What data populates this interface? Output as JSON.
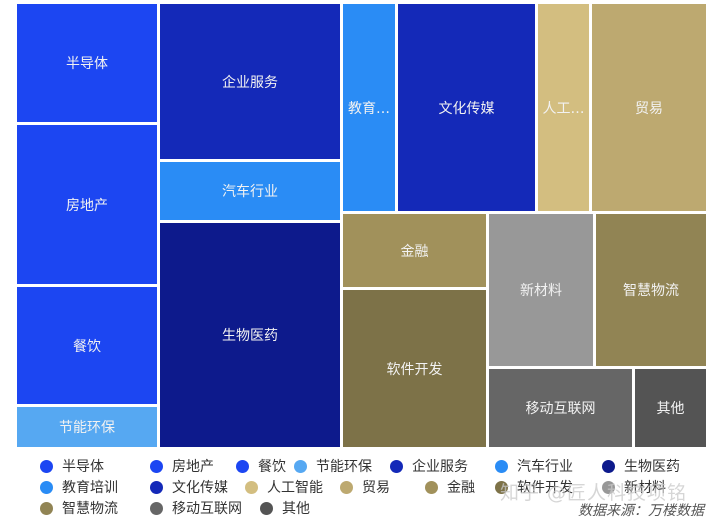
{
  "chart_data": {
    "type": "treemap",
    "title": "",
    "source": "数据来源：万楼数据",
    "watermark": "知乎 @匠人科技项铭",
    "items": [
      {
        "name": "半导体",
        "label": "半导体",
        "value": 16.7,
        "color": "#1c46f2"
      },
      {
        "name": "房地产",
        "label": "房地产",
        "value": 22.4,
        "color": "#1c46f2"
      },
      {
        "name": "餐饮",
        "label": "餐饮",
        "value": 16.5,
        "color": "#1c46f2"
      },
      {
        "name": "节能环保",
        "label": "节能环保",
        "value": 5.5,
        "color": "#56a8f2"
      },
      {
        "name": "企业服务",
        "label": "企业服务",
        "value": 28.1,
        "color": "#1429b8"
      },
      {
        "name": "汽车行业",
        "label": "汽车行业",
        "value": 10.8,
        "color": "#2a8cf5"
      },
      {
        "name": "生物医药",
        "label": "生物医药",
        "value": 39.8,
        "color": "#0d1a8c"
      },
      {
        "name": "教育培训",
        "label": "教育…",
        "value": 11.0,
        "color": "#2a8cf5"
      },
      {
        "name": "文化传媒",
        "label": "文化传媒",
        "value": 27.9,
        "color": "#1429b8"
      },
      {
        "name": "人工智能",
        "label": "人工…",
        "value": 10.8,
        "color": "#d3be80"
      },
      {
        "name": "贸易",
        "label": "贸易",
        "value": 22.4,
        "color": "#bda970"
      },
      {
        "name": "金融",
        "label": "金融",
        "value": 10.9,
        "color": "#a1915b"
      },
      {
        "name": "软件开发",
        "label": "软件开发",
        "value": 22.5,
        "color": "#7d7248"
      },
      {
        "name": "新材料",
        "label": "新材料",
        "value": 16.3,
        "color": "#989898"
      },
      {
        "name": "智慧物流",
        "label": "智慧物流",
        "value": 16.9,
        "color": "#918454"
      },
      {
        "name": "移动互联网",
        "label": "移动互联网",
        "value": 11.2,
        "color": "#666666"
      },
      {
        "name": "其他",
        "label": "其他",
        "value": 5.5,
        "color": "#545454"
      }
    ],
    "legend": {
      "placement": "bottom",
      "rows": [
        [
          "半导体",
          "房地产",
          "餐饮",
          "节能环保",
          "企业服务",
          "汽车行业",
          "生物医药"
        ],
        [
          "教育培训",
          "文化传媒",
          "人工智能",
          "贸易",
          "金融",
          "软件开发",
          "新材料"
        ],
        [
          "智慧物流",
          "移动互联网",
          "其他"
        ]
      ]
    }
  }
}
